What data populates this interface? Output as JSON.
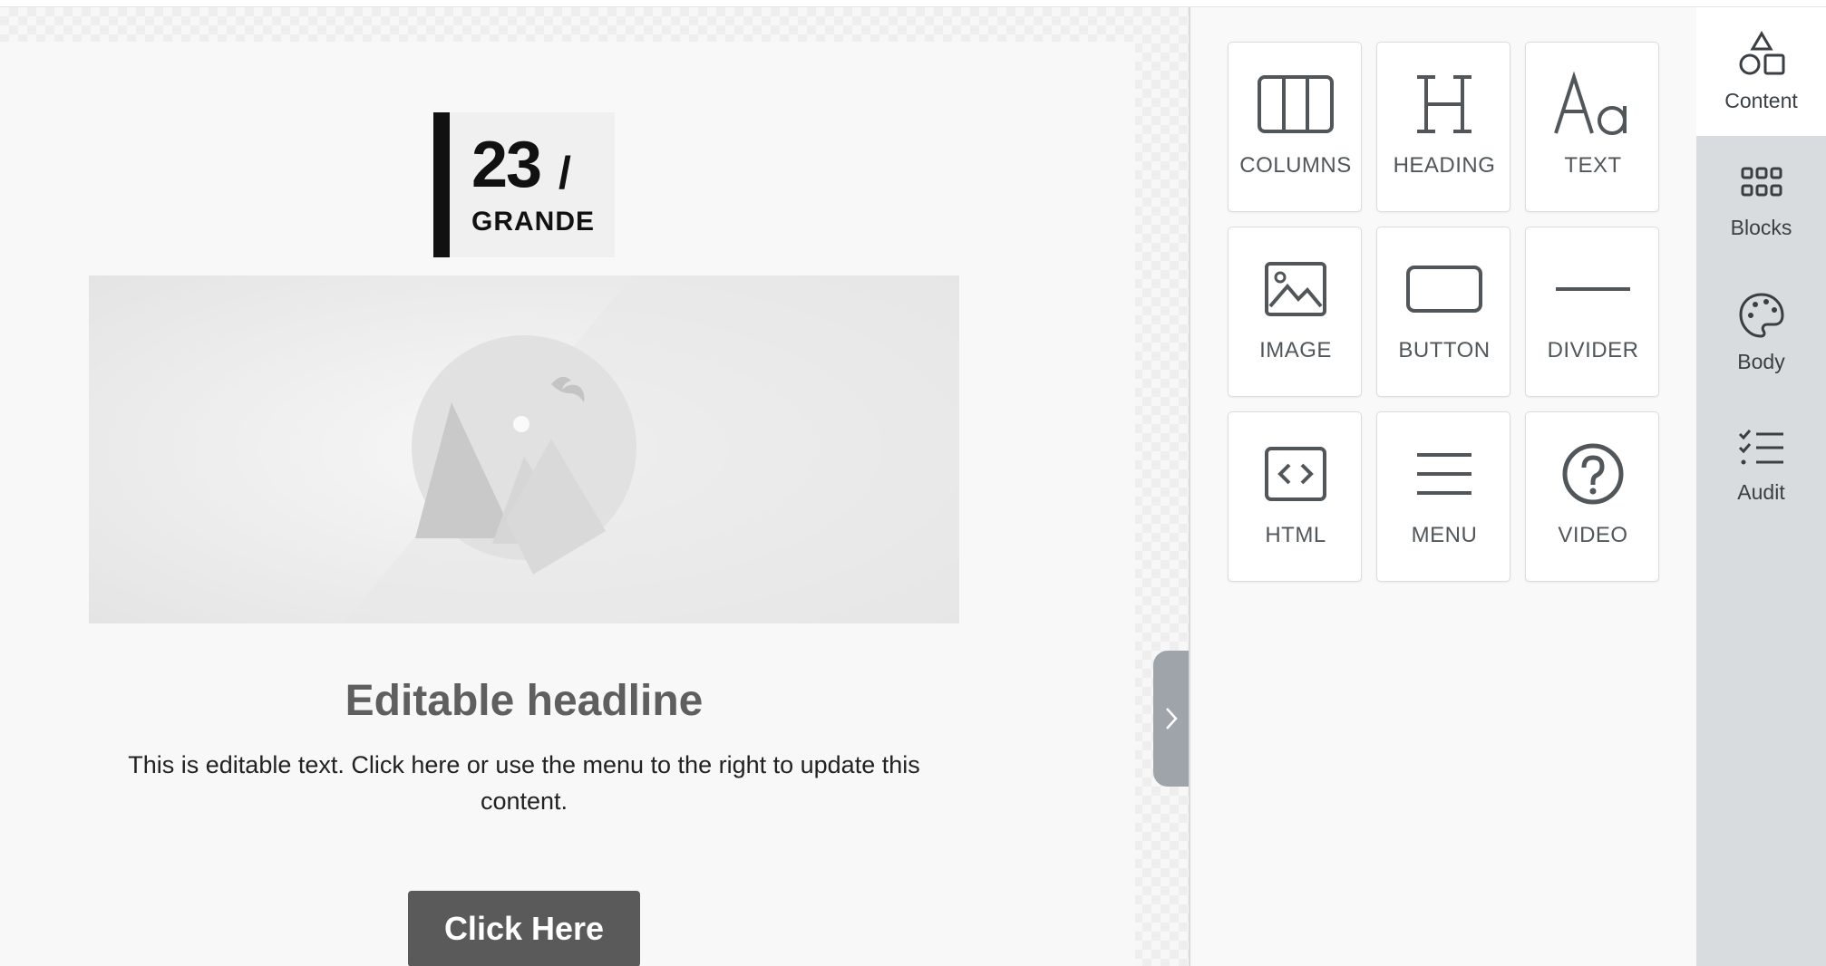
{
  "canvas": {
    "logo": {
      "number": "23",
      "slash": "/",
      "subtitle": "GRANDE"
    },
    "hero_image": {
      "icon": "image-placeholder-icon"
    },
    "headline": "Editable headline",
    "paragraph": "This is editable text. Click here or use the menu to the right to update this content.",
    "button_label": "Click Here",
    "collapse_icon": "chevron-right-icon"
  },
  "tools": {
    "tiles": [
      {
        "label": "COLUMNS",
        "icon": "columns-icon"
      },
      {
        "label": "HEADING",
        "icon": "heading-icon"
      },
      {
        "label": "TEXT",
        "icon": "text-icon"
      },
      {
        "label": "IMAGE",
        "icon": "image-icon"
      },
      {
        "label": "BUTTON",
        "icon": "button-icon"
      },
      {
        "label": "DIVIDER",
        "icon": "divider-icon"
      },
      {
        "label": "HTML",
        "icon": "html-icon"
      },
      {
        "label": "MENU",
        "icon": "menu-icon"
      },
      {
        "label": "VIDEO",
        "icon": "video-icon"
      }
    ]
  },
  "rail": {
    "items": [
      {
        "label": "Content",
        "icon": "shapes-icon",
        "active": true
      },
      {
        "label": "Blocks",
        "icon": "grid-icon",
        "active": false
      },
      {
        "label": "Body",
        "icon": "palette-icon",
        "active": false
      },
      {
        "label": "Audit",
        "icon": "checklist-icon",
        "active": false
      }
    ]
  },
  "colors": {
    "button_bg": "#5a5a5a",
    "headline": "#5f5f5f",
    "rail_bg": "#d9dcdf",
    "tile_text": "#505659"
  }
}
